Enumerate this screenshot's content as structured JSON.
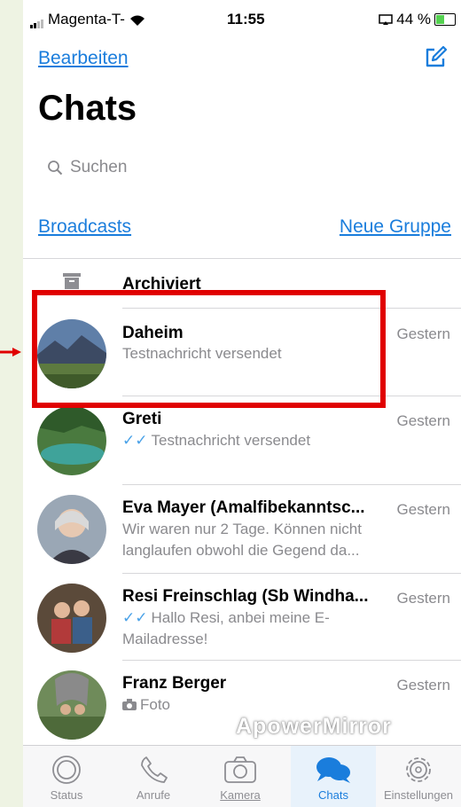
{
  "status_bar": {
    "carrier": "Magenta-T-",
    "time": "11:55",
    "battery": "44 %"
  },
  "header": {
    "edit_label": "Bearbeiten",
    "title": "Chats"
  },
  "search": {
    "placeholder": "Suchen"
  },
  "links": {
    "broadcasts": "Broadcasts",
    "new_group": "Neue Gruppe"
  },
  "archived": {
    "label": "Archiviert"
  },
  "chats": [
    {
      "name": "Daheim",
      "time": "Gestern",
      "message": "Testnachricht versendet",
      "ticks": false
    },
    {
      "name": "Greti",
      "time": "Gestern",
      "message": "Testnachricht versendet",
      "ticks": true
    },
    {
      "name": "Eva Mayer (Amalfibekanntsc...",
      "time": "Gestern",
      "message": "Wir waren nur 2 Tage. Können nicht langlaufen obwohl die Gegend da...",
      "ticks": false
    },
    {
      "name": "Resi Freinschlag (Sb Windha...",
      "time": "Gestern",
      "message": "Hallo Resi, anbei meine E-Mailadresse!",
      "ticks": true
    },
    {
      "name": "Franz Berger",
      "time": "Gestern",
      "message": "Foto",
      "ticks": false
    }
  ],
  "watermark": "ApowerMirror",
  "tabs": [
    {
      "label": "Status"
    },
    {
      "label": "Anrufe"
    },
    {
      "label": "Kamera"
    },
    {
      "label": "Chats"
    },
    {
      "label": "Einstellungen"
    }
  ],
  "colors": {
    "accent": "#1a7ddc",
    "highlight_box": "#e00000",
    "secondary_text": "#8a8a8e"
  }
}
